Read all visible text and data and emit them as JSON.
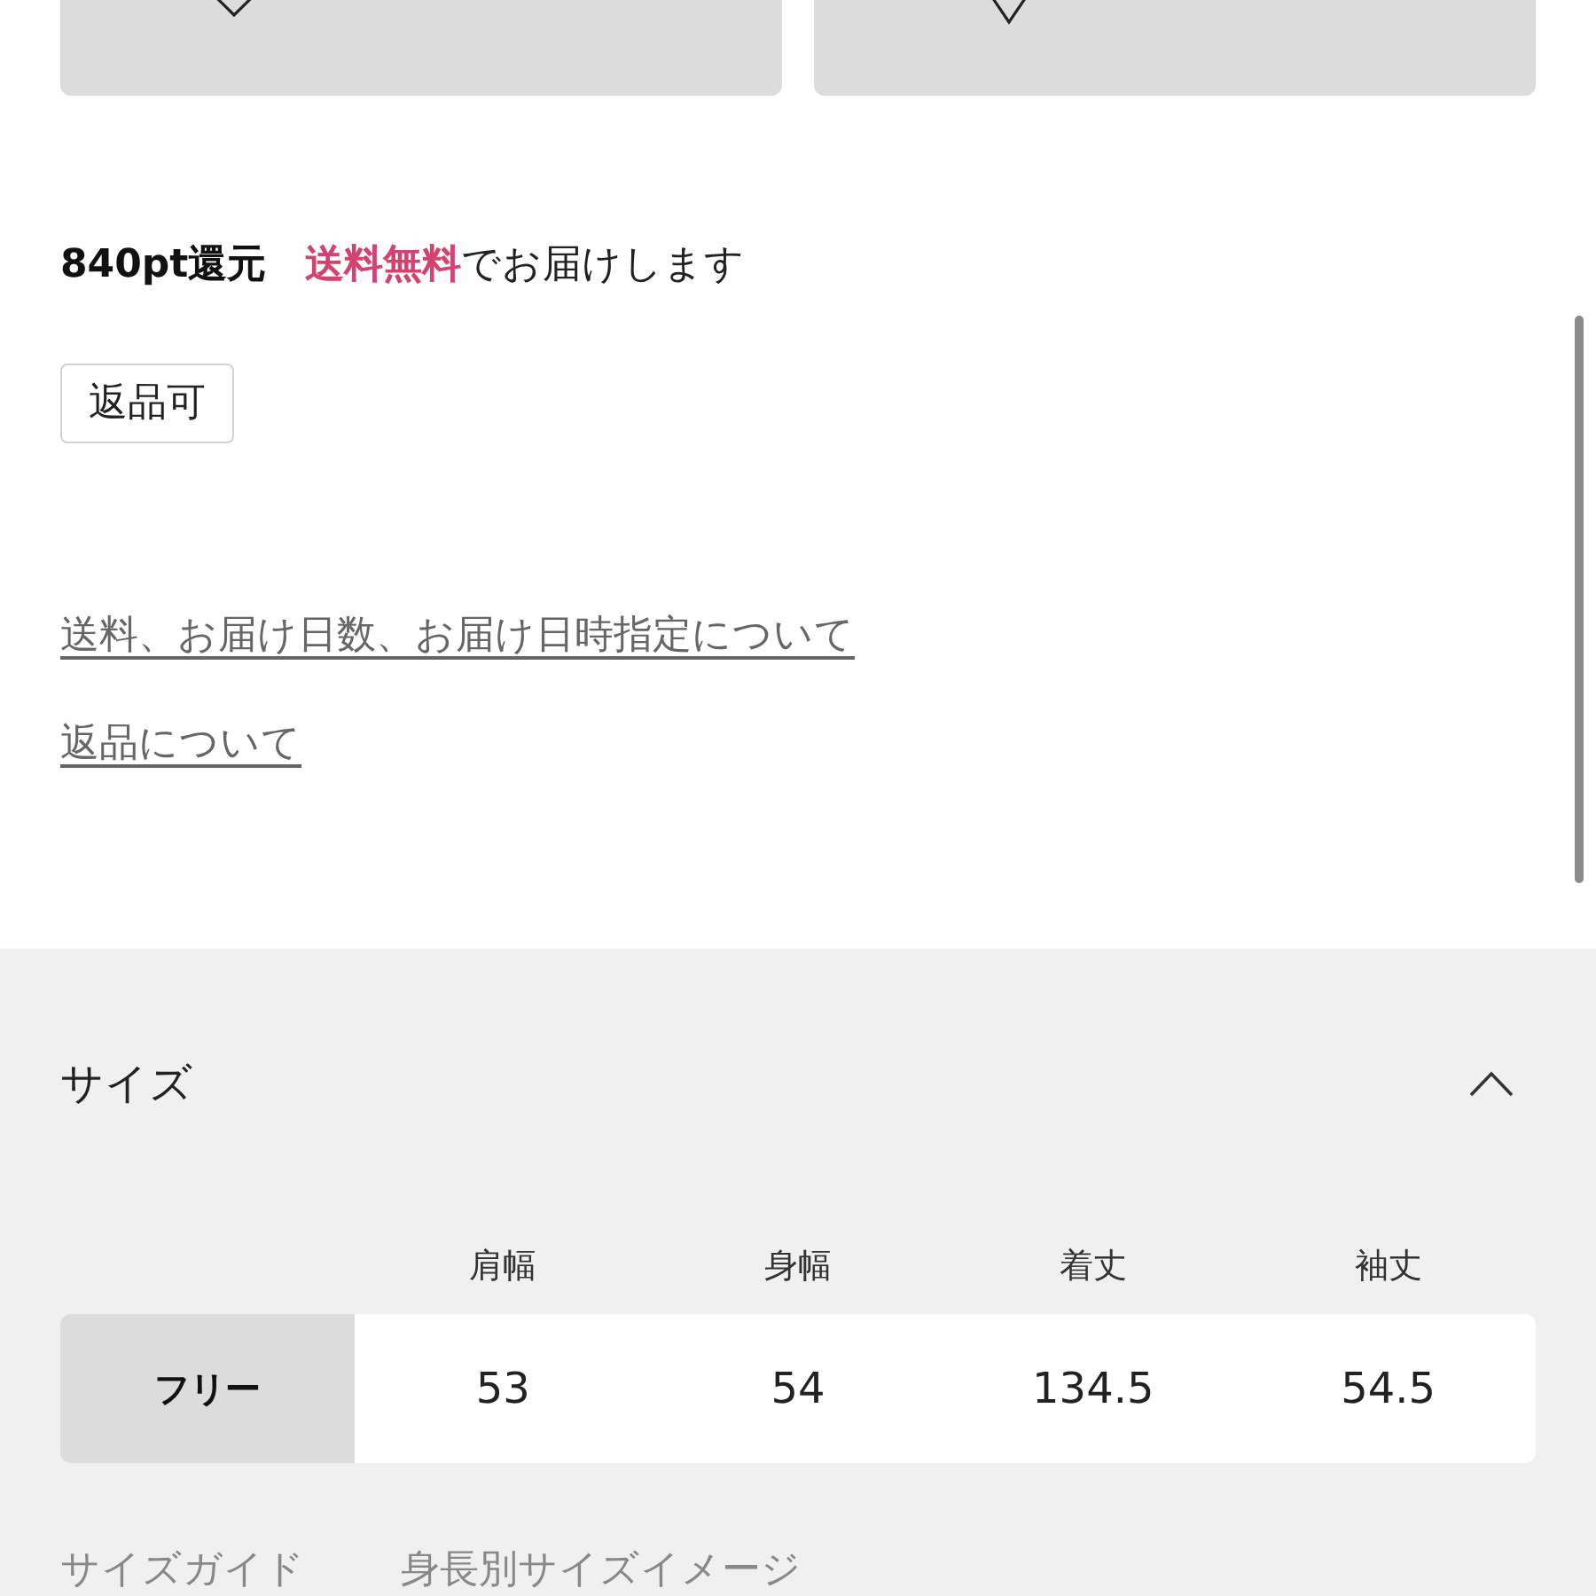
{
  "action_buttons": [
    {
      "kind": "favorite"
    },
    {
      "kind": "store"
    }
  ],
  "points": "840pt還元",
  "shipping": "**送料無料**でお届けします",
  "tags": [
    "返品可"
  ],
  "links": [
    "送料、お届け日数、お届け日時指定について",
    "返品について"
  ],
  "size_section": {
    "title": "サイズ",
    "expanded": true,
    "table": {
      "columns": [
        "肩幅",
        "身幅",
        "着丈",
        "袖丈"
      ],
      "rows": [
        {
          "size": "フリー",
          "values": [
            "53",
            "54",
            "134.5",
            "54.5"
          ]
        }
      ]
    },
    "links": [
      "サイズガイド",
      "身長別サイズイメージ"
    ]
  }
}
